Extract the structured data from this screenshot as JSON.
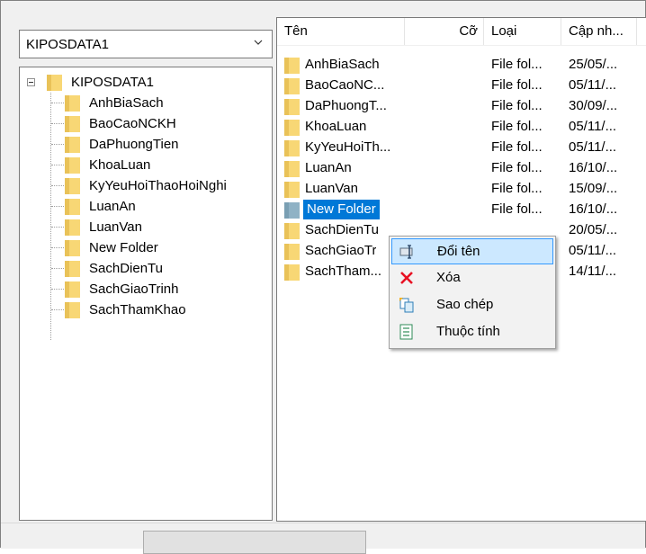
{
  "left": {
    "combo_value": "KIPOSDATA1",
    "tree_root": "KIPOSDATA1",
    "tree_items": [
      "AnhBiaSach",
      "BaoCaoNCKH",
      "DaPhuongTien",
      "KhoaLuan",
      "KyYeuHoiThaoHoiNghi",
      "LuanAn",
      "LuanVan",
      "New Folder",
      "SachDienTu",
      "SachGiaoTrinh",
      "SachThamKhao"
    ]
  },
  "right": {
    "headers": [
      "Tên",
      "Cỡ",
      "Loại",
      "Cập nh..."
    ],
    "rows": [
      {
        "name": "AnhBiaSach",
        "type": "File fol...",
        "date": "25/05/..."
      },
      {
        "name": "BaoCaoNC...",
        "type": "File fol...",
        "date": "05/11/..."
      },
      {
        "name": "DaPhuongT...",
        "type": "File fol...",
        "date": "30/09/..."
      },
      {
        "name": "KhoaLuan",
        "type": "File fol...",
        "date": "05/11/..."
      },
      {
        "name": "KyYeuHoiTh...",
        "type": "File fol...",
        "date": "05/11/..."
      },
      {
        "name": "LuanAn",
        "type": "File fol...",
        "date": "16/10/..."
      },
      {
        "name": "LuanVan",
        "type": "File fol...",
        "date": "15/09/..."
      },
      {
        "name": "New Folder",
        "type": "File fol...",
        "date": "16/10/..."
      },
      {
        "name": "SachDienTu",
        "type": "",
        "date": "20/05/..."
      },
      {
        "name": "SachGiaoTr",
        "type": "",
        "date": "05/11/..."
      },
      {
        "name": "SachTham...",
        "type": "",
        "date": "14/11/..."
      }
    ]
  },
  "context_menu": {
    "items": [
      {
        "label": "Đổi tên",
        "icon": "rename-icon"
      },
      {
        "label": "Xóa",
        "icon": "delete-icon"
      },
      {
        "label": "Sao chép",
        "icon": "copy-icon"
      },
      {
        "label": "Thuộc tính",
        "icon": "properties-icon"
      }
    ]
  },
  "colors": {
    "selection": "#0078d7",
    "menu_hover": "#cce8ff",
    "folder": "#f8d775",
    "delete_red": "#e81123"
  }
}
